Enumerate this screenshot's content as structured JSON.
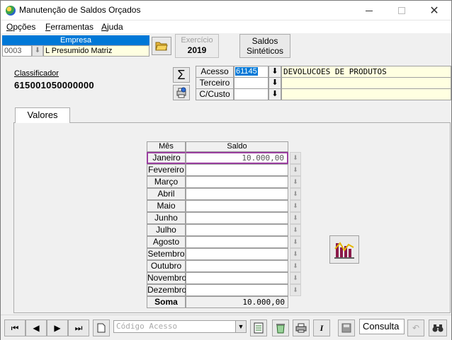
{
  "window": {
    "title": "Manutenção de Saldos Orçados"
  },
  "menu": {
    "items": [
      {
        "label": "Opções"
      },
      {
        "label": "Ferramentas"
      },
      {
        "label": "Ajuda"
      }
    ]
  },
  "empresa": {
    "header": "Empresa",
    "code": "0003",
    "name": "L Presumido Matriz"
  },
  "exercicio": {
    "label": "Exercício",
    "value": "2019"
  },
  "saldos_button": {
    "line1": "Saldos",
    "line2": "Sintéticos"
  },
  "classificador": {
    "label": "Classificador",
    "value": "615001050000000"
  },
  "fields": [
    {
      "label": "Acesso",
      "value": "61145",
      "description": "DEVOLUCOES DE PRODUTOS"
    },
    {
      "label": "Terceiro",
      "value": "",
      "description": ""
    },
    {
      "label": "C/Custo",
      "value": "",
      "description": ""
    }
  ],
  "tab": {
    "label": "Valores"
  },
  "table": {
    "headers": {
      "mes": "Mês",
      "saldo": "Saldo"
    },
    "rows": [
      {
        "mes": "Janeiro",
        "saldo": "10.000,00"
      },
      {
        "mes": "Fevereiro",
        "saldo": ""
      },
      {
        "mes": "Março",
        "saldo": ""
      },
      {
        "mes": "Abril",
        "saldo": ""
      },
      {
        "mes": "Maio",
        "saldo": ""
      },
      {
        "mes": "Junho",
        "saldo": ""
      },
      {
        "mes": "Julho",
        "saldo": ""
      },
      {
        "mes": "Agosto",
        "saldo": ""
      },
      {
        "mes": "Setembro",
        "saldo": ""
      },
      {
        "mes": "Outubro",
        "saldo": ""
      },
      {
        "mes": "Novembro",
        "saldo": ""
      },
      {
        "mes": "Dezembro",
        "saldo": ""
      }
    ],
    "soma": {
      "label": "Soma",
      "value": "10.000,00"
    }
  },
  "toolbar": {
    "combo_placeholder": "Código Acesso",
    "mode": "Consulta"
  },
  "colors": {
    "accent": "#0078d7",
    "highlight": "#9b3fa0",
    "field_bg": "#ffffe1"
  }
}
